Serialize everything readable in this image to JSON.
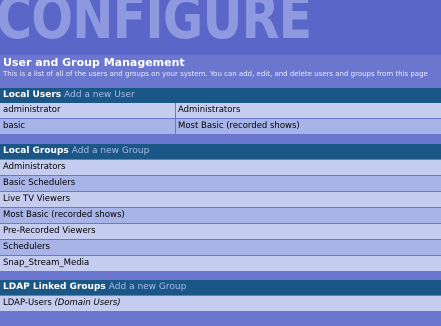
{
  "banner": {
    "word": "CONFIGURE"
  },
  "page": {
    "title": "User and Group Management",
    "description": "This is a list of all of the users and groups on your system.  You can add, edit, and delete users and groups from this page"
  },
  "local_users": {
    "heading": "Local Users",
    "add_link": "Add a new User",
    "rows": [
      {
        "name": "administrator",
        "group": "Administrators"
      },
      {
        "name": "basic",
        "group": "Most Basic (recorded shows)"
      }
    ]
  },
  "local_groups": {
    "heading": "Local Groups",
    "add_link": "Add a new Group",
    "rows": [
      "Administrators",
      "Basic Schedulers",
      "Live TV Viewers",
      "Most Basic (recorded shows)",
      "Pre-Recorded Viewers",
      "Schedulers",
      "Snap_Stream_Media"
    ]
  },
  "ldap_groups": {
    "heading": "LDAP Linked Groups",
    "add_link": "Add a new Group",
    "rows": [
      {
        "name": "LDAP-Users",
        "note": "(Domain Users)"
      }
    ]
  }
}
